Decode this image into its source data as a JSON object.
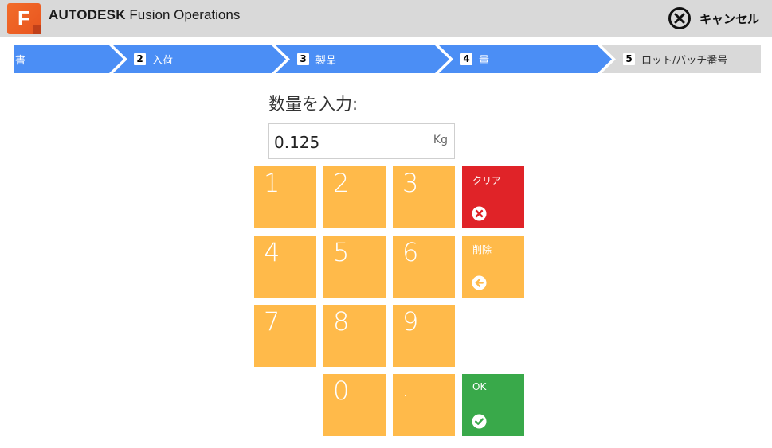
{
  "header": {
    "logo_letter": "F",
    "brand_bold": "AUTODESK",
    "brand_rest": " Fusion Operations",
    "cancel_label": "キャンセル",
    "cancel_icon": "circle-x-icon"
  },
  "steps": [
    {
      "number": "",
      "label": "書",
      "active": true
    },
    {
      "number": "2",
      "label": "入荷",
      "active": true
    },
    {
      "number": "3",
      "label": "製品",
      "active": true
    },
    {
      "number": "4",
      "label": "量",
      "active": true
    },
    {
      "number": "5",
      "label": "ロット/バッチ番号",
      "active": false
    }
  ],
  "entry": {
    "prompt": "数量を入力:",
    "value": "0.125",
    "unit": "Kg"
  },
  "keypad": {
    "digits": [
      "1",
      "2",
      "3",
      "4",
      "5",
      "6",
      "7",
      "8",
      "9",
      "0",
      "."
    ],
    "clear_label": "クリア",
    "clear_icon": "circle-x-icon",
    "delete_label": "削除",
    "delete_icon": "circle-arrow-left-icon",
    "ok_label": "OK",
    "ok_icon": "circle-check-icon"
  },
  "colors": {
    "step_active": "#4b8ef5",
    "step_inactive": "#d9d9d9",
    "key": "#ffba4a",
    "clear": "#e02328",
    "ok": "#39a94a"
  }
}
